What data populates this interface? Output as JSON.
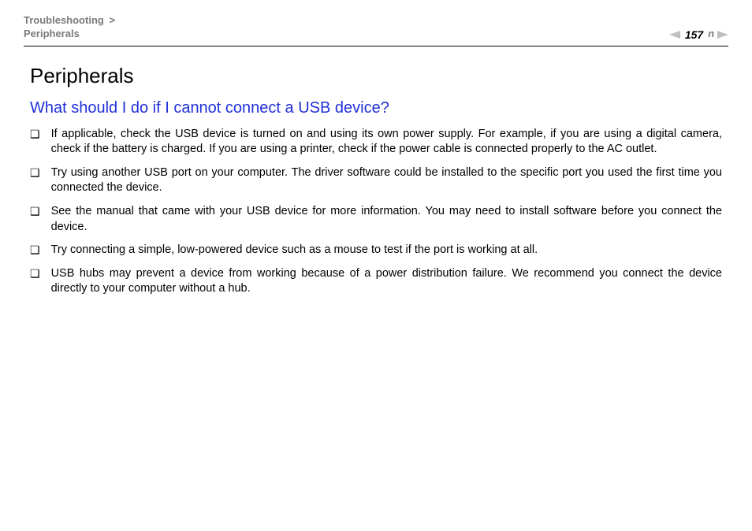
{
  "header": {
    "breadcrumb_top": "Troubleshooting",
    "breadcrumb_sep": ">",
    "breadcrumb_bottom": "Peripherals",
    "page_number": "157",
    "n_glyph": "n"
  },
  "content": {
    "title": "Peripherals",
    "question": "What should I do if I cannot connect a USB device?",
    "bullets": [
      "If applicable, check the USB device is turned on and using its own power supply. For example, if you are using a digital camera, check if the battery is charged. If you are using a printer, check if the power cable is connected properly to the AC outlet.",
      "Try using another USB port on your computer. The driver software could be installed to the specific port you used the first time you connected the device.",
      "See the manual that came with your USB device for more information. You may need to install software before you connect the device.",
      "Try connecting a simple, low-powered device such as a mouse to test if the port is working at all.",
      "USB hubs may prevent a device from working because of a power distribution failure. We recommend you connect the device directly to your computer without a hub."
    ],
    "bullet_glyph": "❑"
  }
}
